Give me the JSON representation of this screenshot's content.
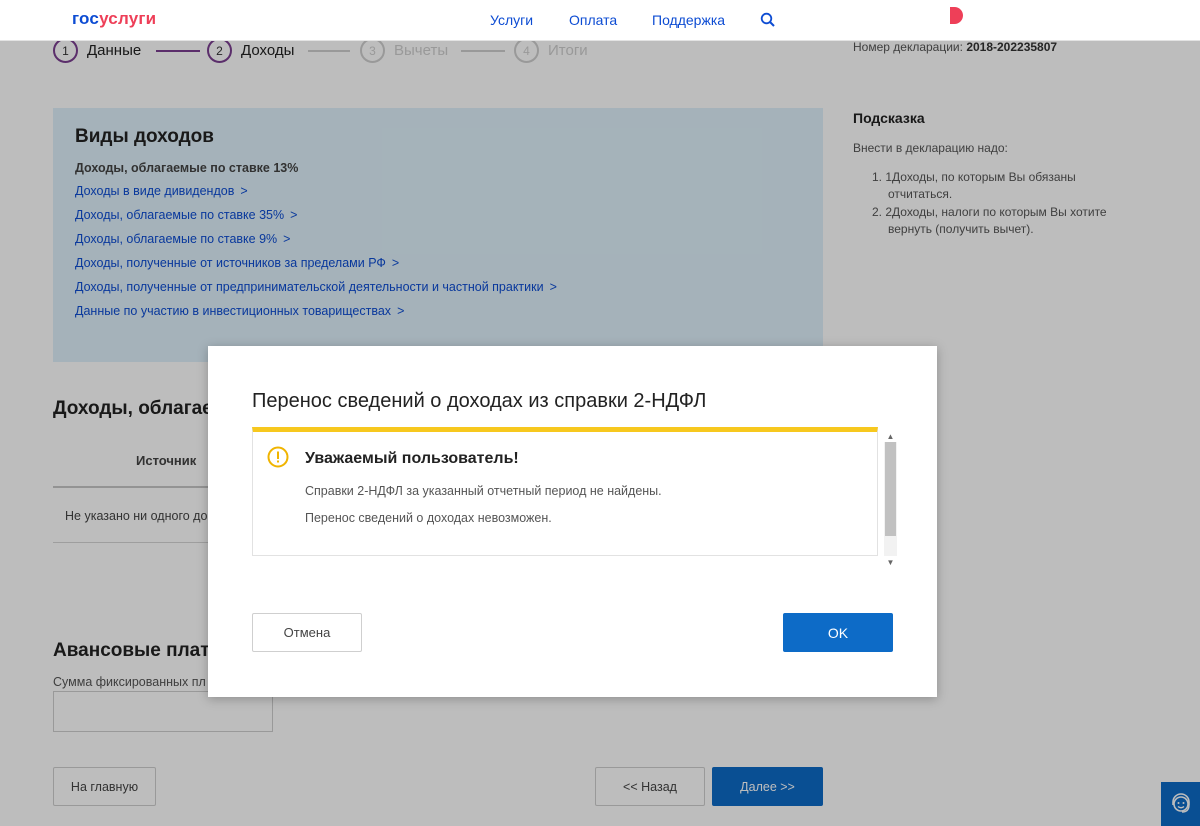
{
  "header": {
    "logo_part1": "гос",
    "logo_part2": "услуги",
    "nav": [
      "Услуги",
      "Оплата",
      "Поддержка"
    ],
    "search_icon": "search-icon",
    "brand_blue": "#0d4cd3",
    "brand_red": "#ee3f58"
  },
  "steps": [
    {
      "num": "1",
      "label": "Данные",
      "state": "done"
    },
    {
      "num": "2",
      "label": "Доходы",
      "state": "current"
    },
    {
      "num": "3",
      "label": "Вычеты",
      "state": "inactive"
    },
    {
      "num": "4",
      "label": "Итоги",
      "state": "inactive"
    }
  ],
  "declaration": {
    "label": "Номер декларации:",
    "number": "2018-202235807"
  },
  "income_types": {
    "title": "Виды доходов",
    "current": "Доходы, облагаемые по ставке 13%",
    "links": [
      "Доходы в виде дивидендов",
      "Доходы, облагаемые по ставке 35%",
      "Доходы, облагаемые по ставке 9%",
      "Доходы, полученные от источников за пределами РФ",
      "Доходы, полученные от предпринимательской деятельности и частной практики",
      "Данные по участию в инвестиционных товариществах"
    ],
    "chevron": ">"
  },
  "hint": {
    "title": "Подсказка",
    "intro": "Внести в декларацию надо:",
    "items": [
      "1. 1Доходы, по которым Вы обязаны отчитаться.",
      "2. 2Доходы, налоги по которым Вы хотите вернуть (получить вычет)."
    ]
  },
  "income_section": {
    "title": "Доходы, облагае",
    "column": "Источник",
    "empty": "Не указано ни одного до"
  },
  "advance_section": {
    "title": "Авансовые плат",
    "field_label": "Сумма фиксированных пл",
    "field_value": ""
  },
  "footer_buttons": {
    "home": "На главную",
    "back": "<< Назад",
    "next": "Далее >>"
  },
  "modal": {
    "title": "Перенос сведений о доходах из справки 2-НДФЛ",
    "notice_heading": "Уважаемый пользователь!",
    "notice_line1": "Справки 2-НДФЛ за указанный отчетный период не найдены.",
    "notice_line2": "Перенос сведений о доходах невозможен.",
    "cancel": "Отмена",
    "ok": "OK",
    "warning_color": "#f7c81e"
  },
  "colors": {
    "primary_button": "#0d6bc7",
    "step_active": "#7b3f91",
    "info_box_bg": "#dff1fb"
  }
}
